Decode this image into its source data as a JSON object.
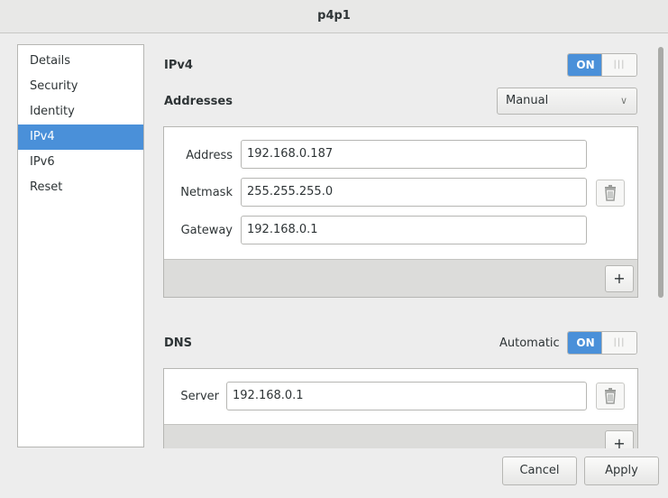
{
  "window": {
    "title": "p4p1"
  },
  "sidebar": {
    "items": [
      {
        "label": "Details"
      },
      {
        "label": "Security"
      },
      {
        "label": "Identity"
      },
      {
        "label": "IPv4",
        "active": true
      },
      {
        "label": "IPv6"
      },
      {
        "label": "Reset"
      }
    ]
  },
  "ipv4": {
    "heading": "IPv4",
    "switch_label": "ON",
    "addresses_label": "Addresses",
    "method": "Manual",
    "address_label": "Address",
    "address_value": "192.168.0.187",
    "netmask_label": "Netmask",
    "netmask_value": "255.255.255.0",
    "gateway_label": "Gateway",
    "gateway_value": "192.168.0.1",
    "add_label": "+"
  },
  "dns": {
    "heading": "DNS",
    "automatic_label": "Automatic",
    "switch_label": "ON",
    "server_label": "Server",
    "server_value": "192.168.0.1",
    "add_label": "+"
  },
  "buttons": {
    "cancel": "Cancel",
    "apply": "Apply"
  },
  "colors": {
    "accent": "#4a90d9"
  }
}
